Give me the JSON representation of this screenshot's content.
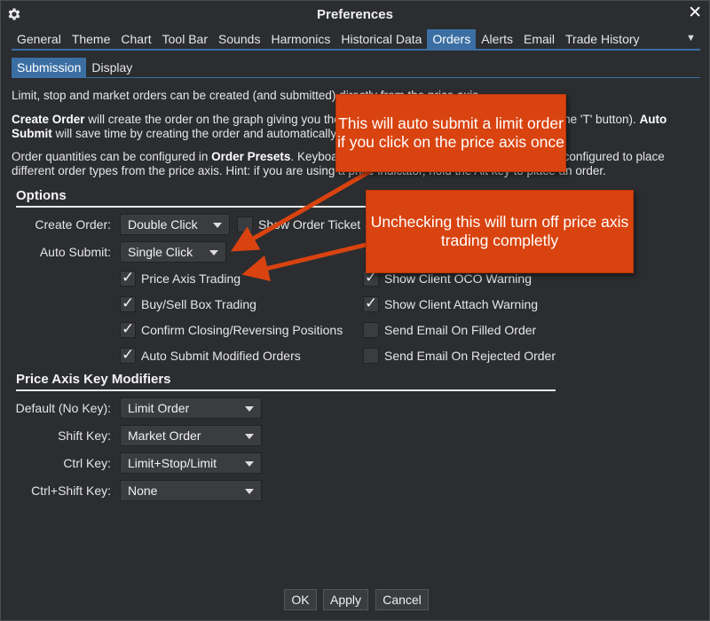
{
  "window": {
    "title": "Preferences"
  },
  "tabs": [
    {
      "label": "General",
      "active": false
    },
    {
      "label": "Theme",
      "active": false
    },
    {
      "label": "Chart",
      "active": false
    },
    {
      "label": "Tool Bar",
      "active": false
    },
    {
      "label": "Sounds",
      "active": false
    },
    {
      "label": "Harmonics",
      "active": false
    },
    {
      "label": "Historical Data",
      "active": false
    },
    {
      "label": "Orders",
      "active": true
    },
    {
      "label": "Alerts",
      "active": false
    },
    {
      "label": "Email",
      "active": false
    },
    {
      "label": "Trade History",
      "active": false
    }
  ],
  "subtabs": [
    {
      "label": "Submission",
      "active": true
    },
    {
      "label": "Display",
      "active": false
    }
  ],
  "intro": {
    "line1": "Limit, stop and market orders can be created (and submitted) directly from the price axis.",
    "create_order_bold": "Create Order",
    "create_order_text": " will create the order on the graph giving you the ability to adjust and then submit it (using the 'T' button).  ",
    "auto_submit_bold": "Auto Submit",
    "auto_submit_text": " will save time by creating the order and automatically submitting it.",
    "quantities_text1": "Order quantities can be configured in ",
    "order_presets_bold": "Order Presets",
    "quantities_text2": ".  Keyboard modifiers (Shift, Ctrl, Ctrl+Shift) may be configured to place different order types from the price axis.  Hint: if you are using a price indicator, hold the Alt key to place an order."
  },
  "options": {
    "title": "Options",
    "create_order_label": "Create Order:",
    "create_order_value": "Double Click",
    "auto_submit_label": "Auto Submit:",
    "auto_submit_value": "Single Click",
    "show_order_ticket": {
      "label": "Show Order Ticket",
      "checked": false
    },
    "left_checks": [
      {
        "label": "Price Axis Trading",
        "checked": true
      },
      {
        "label": "Buy/Sell Box Trading",
        "checked": true
      },
      {
        "label": "Confirm Closing/Reversing Positions",
        "checked": true
      },
      {
        "label": "Auto Submit Modified Orders",
        "checked": true
      }
    ],
    "right_checks": [
      {
        "label": "Show Client OCO Warning",
        "checked": true
      },
      {
        "label": "Show Client Attach Warning",
        "checked": true
      },
      {
        "label": "Send Email On Filled Order",
        "checked": false
      },
      {
        "label": "Send Email On Rejected Order",
        "checked": false
      }
    ]
  },
  "modifiers": {
    "title": "Price Axis Key Modifiers",
    "rows": [
      {
        "label": "Default (No Key):",
        "value": "Limit Order"
      },
      {
        "label": "Shift Key:",
        "value": "Market Order"
      },
      {
        "label": "Ctrl Key:",
        "value": "Limit+Stop/Limit"
      },
      {
        "label": "Ctrl+Shift Key:",
        "value": "None"
      }
    ]
  },
  "buttons": {
    "ok": "OK",
    "apply": "Apply",
    "cancel": "Cancel"
  },
  "callouts": {
    "first": "This will auto submit a limit order if you click on the price axis once",
    "second": "Unchecking this will turn off price axis trading completly"
  },
  "colors": {
    "accent": "#3b6fa3",
    "callout": "#d9430f",
    "background": "#2b2d30"
  },
  "icons": {
    "gear": "gear-icon",
    "close": "close-icon",
    "more": "chevron-down-icon"
  }
}
